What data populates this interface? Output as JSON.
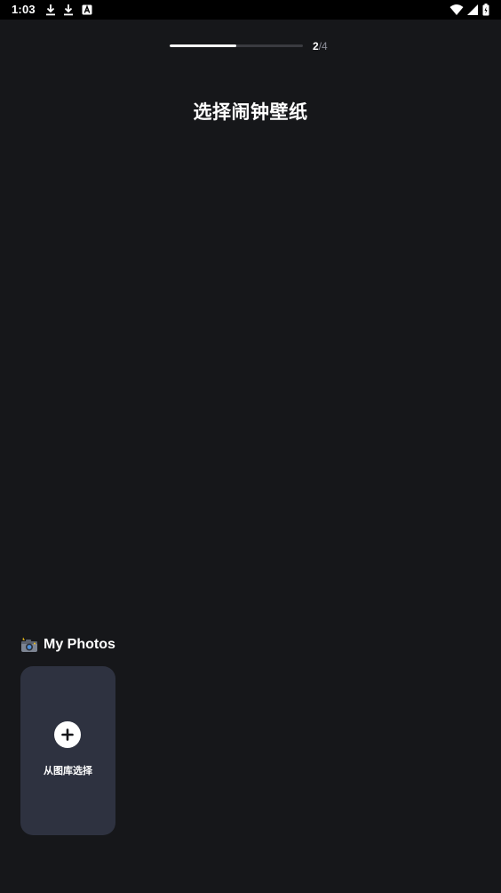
{
  "status_bar": {
    "time": "1:03",
    "icons": [
      "download-icon",
      "download-icon",
      "app-notification-icon",
      "wifi-icon",
      "signal-icon",
      "battery-icon"
    ]
  },
  "progress": {
    "current": "2",
    "separator_total": "/4",
    "fraction": 0.5
  },
  "title": "选择闹钟壁纸",
  "section": {
    "icon": "camera-flash-emoji",
    "label": "My Photos"
  },
  "gallery_card": {
    "label": "从图库选择",
    "icon": "add-icon"
  },
  "colors": {
    "background": "#16171a",
    "card": "#2e3240",
    "progress_track": "#3a3b40",
    "progress_fill": "#ffffff",
    "muted_text": "#8c8e99"
  }
}
